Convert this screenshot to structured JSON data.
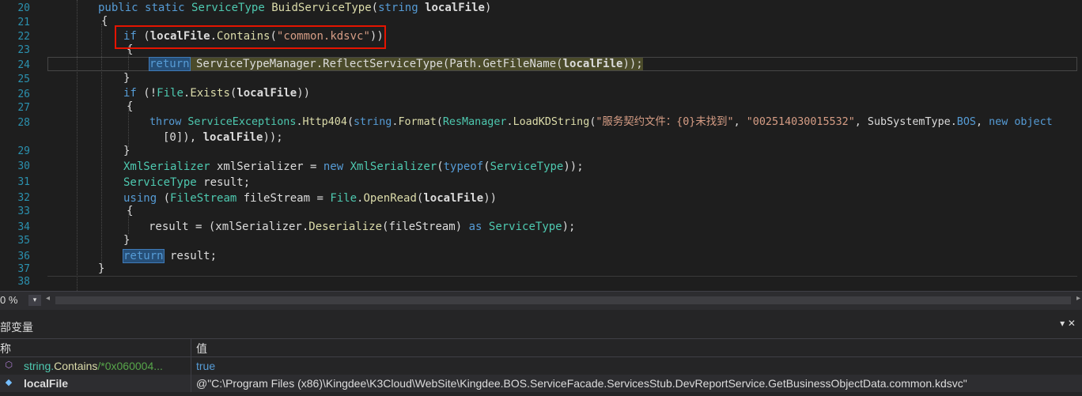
{
  "editor": {
    "line_numbers": [
      "20",
      "21",
      "22",
      "23",
      "24",
      "25",
      "26",
      "27",
      "28",
      "",
      "29",
      "30",
      "31",
      "32",
      "33",
      "34",
      "35",
      "36",
      "37",
      "38"
    ],
    "lines": {
      "l20": {
        "kw1": "public",
        "kw2": "static",
        "type": "ServiceType",
        "method": "BuidServiceType",
        "p1": "(",
        "kw3": "string",
        "arg": "localFile",
        "p2": ")"
      },
      "l21": {
        "text": "{"
      },
      "l22": {
        "kw": "if",
        "p1": " (",
        "var": "localFile",
        "dot": ".",
        "method": "Contains",
        "p2": "(",
        "str": "\"common.kdsvc\"",
        "p3": "))"
      },
      "l23": {
        "text": "{"
      },
      "l24": {
        "kw": "return",
        "rest1": " ServiceTypeManager.ReflectServiceType(Path.GetFileName(",
        "var": "localFile",
        "rest2": "));"
      },
      "l25": {
        "text": "}"
      },
      "l26": {
        "kw": "if",
        "p1": " (!",
        "type": "File",
        "dot": ".",
        "method": "Exists",
        "p2": "(",
        "var": "localFile",
        "p3": "))"
      },
      "l27": {
        "text": "{"
      },
      "l28": {
        "kw": "throw",
        "sp": " ",
        "type": "ServiceExceptions",
        "dot": ".",
        "method": "Http404",
        "p1": "(",
        "kw2": "string",
        "dot2": ".",
        "method2": "Format",
        "p2": "(",
        "type2": "ResManager",
        "dot3": ".",
        "method3": "LoadKDString",
        "p3": "(",
        "str1": "\"服务契约文件：{0}未找到\"",
        "c1": ", ",
        "str2": "\"002514030015532\"",
        "c2": ", SubSystemType.",
        "en": "BOS",
        "c3": ", ",
        "kw3": "new",
        "sp2": " ",
        "kw4": "object"
      },
      "l28b": {
        "text": "[0]), ",
        "var": "localFile",
        "end": "));"
      },
      "l29": {
        "text": "}"
      },
      "l30": {
        "type": "XmlSerializer",
        "mid": " xmlSerializer = ",
        "kw": "new",
        "sp": " ",
        "type2": "XmlSerializer",
        "p1": "(",
        "kw2": "typeof",
        "p2": "(",
        "type3": "ServiceType",
        "end": "));"
      },
      "l31": {
        "type": "ServiceType",
        "rest": " result;"
      },
      "l32": {
        "kw": "using",
        "p1": " (",
        "type": "FileStream",
        "mid": " fileStream = ",
        "type2": "File",
        "dot": ".",
        "method": "OpenRead",
        "p2": "(",
        "var": "localFile",
        "end": "))"
      },
      "l33": {
        "text": "{"
      },
      "l34": {
        "pre": "result = (xmlSerializer.",
        "method": "Deserialize",
        "mid": "(fileStream) ",
        "kw": "as",
        "sp": " ",
        "type": "ServiceType",
        "end": ");"
      },
      "l35": {
        "text": "}"
      },
      "l36": {
        "kw": "return",
        "rest": " result;"
      },
      "l37": {
        "text": "}"
      }
    }
  },
  "status": {
    "zoom": "0 %",
    "zoom_dropdown_icon": "chevron-down-icon",
    "scroll_left_icon": "scroll-left-icon",
    "scroll_right_icon": "scroll-right-icon"
  },
  "locals": {
    "title": "部变量",
    "columns": {
      "name": "称",
      "value": "值"
    },
    "rows": [
      {
        "icon": "method-icon",
        "name_pre": "string.",
        "name_method": "Contains",
        "name_comment": "/*0x060004...",
        "value": "true",
        "value_color": "#569cd6"
      },
      {
        "icon": "variable-icon",
        "name": "localFile",
        "value": "@\"C:\\Program Files (x86)\\Kingdee\\K3Cloud\\WebSite\\Kingdee.BOS.ServiceFacade.ServicesStub.DevReportService.GetBusinessObjectData.common.kdsvc\""
      }
    ]
  },
  "colors": {
    "background": "#1e1e1e",
    "keyword": "#569cd6",
    "type": "#4ec9b0",
    "method": "#dcdcaa",
    "string": "#d69d85",
    "highlight_box": "#e51400"
  }
}
